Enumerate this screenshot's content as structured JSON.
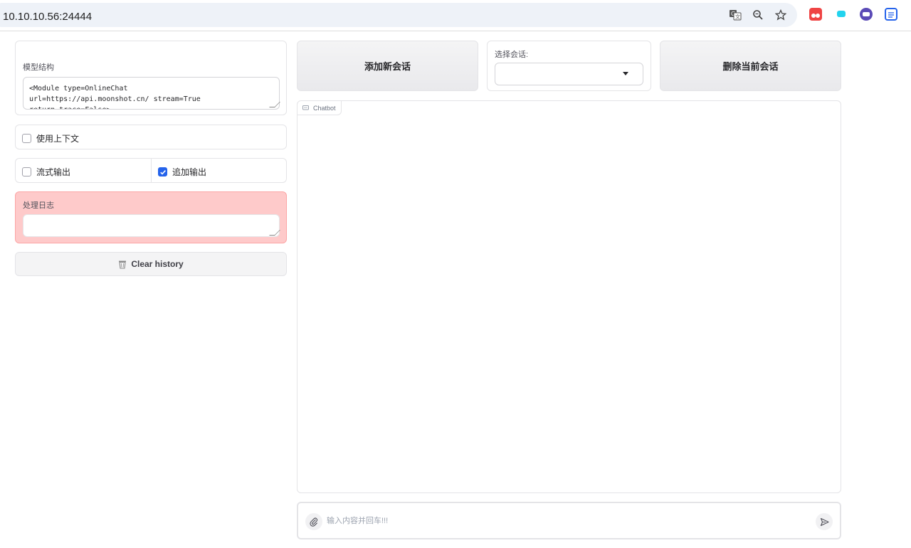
{
  "browser": {
    "url": "10.10.10.56:24444",
    "icons": [
      "translate-icon",
      "zoom-icon",
      "bookmark-star-icon"
    ],
    "extensions": [
      "extension-red-icon",
      "extension-cyan-icon",
      "extension-purple-icon",
      "extension-reader-icon"
    ]
  },
  "left": {
    "model": {
      "label": "模型结构",
      "code": "<Module type=OnlineChat\nurl=https://api.moonshot.cn/ stream=True\nreturn_trace=False>"
    },
    "use_context": {
      "label": "使用上下文",
      "checked": false
    },
    "stream_output": {
      "label": "流式输出",
      "checked": false
    },
    "append_output": {
      "label": "追加输出",
      "checked": true
    },
    "log": {
      "label": "处理日志",
      "value": ""
    },
    "clear_button": "Clear history"
  },
  "top": {
    "add_session": "添加新会话",
    "select_label": "选择会话:",
    "select_value": "",
    "delete_session": "删除当前会话"
  },
  "chat": {
    "tag": "Chatbot",
    "placeholder": "输入内容并回车!!!"
  },
  "colors": {
    "log_background": "#fecaca",
    "checkbox_checked": "#2563eb"
  }
}
